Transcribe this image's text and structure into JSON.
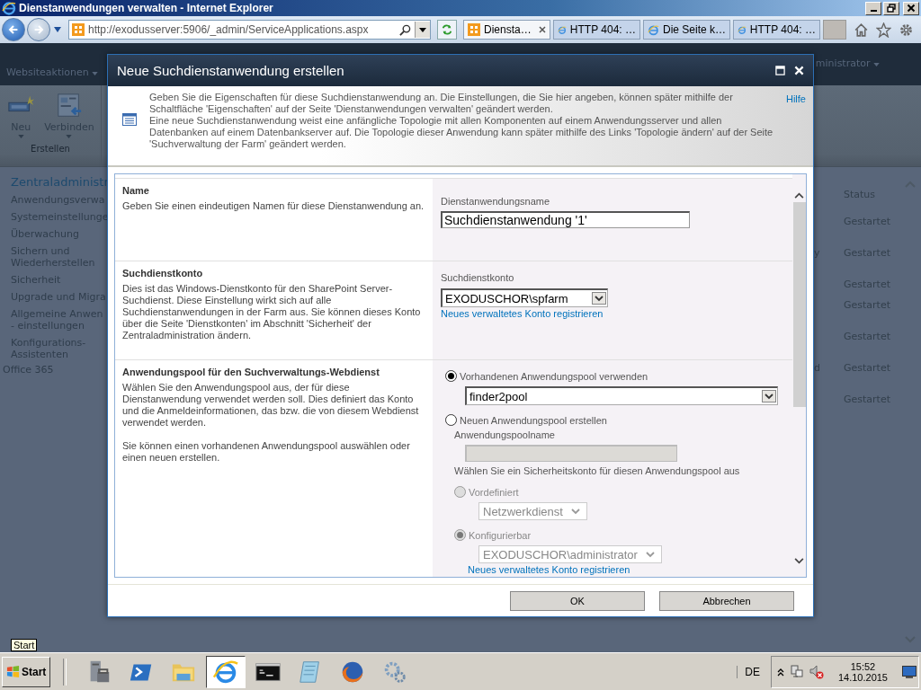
{
  "window": {
    "title": "Dienstanwendungen verwalten - Internet Explorer"
  },
  "address_bar": {
    "url": "http://exodusserver:5906/_admin/ServiceApplications.aspx"
  },
  "tabs": [
    {
      "label": "Diensta…",
      "selected": true
    },
    {
      "label": "HTTP 404: …",
      "selected": false
    },
    {
      "label": "Die Seite k…",
      "selected": false
    },
    {
      "label": "HTTP 404: …",
      "selected": false
    }
  ],
  "page": {
    "site_actions": "Websiteaktionen",
    "user": "ministrator",
    "ribbon": {
      "buttons": [
        "Neu",
        "Verbinden"
      ],
      "group": "Erstellen"
    },
    "nav_heading": "Zentraladministr",
    "nav": [
      "Anwendungsverwa",
      "Systemeinstellunge",
      "Überwachung",
      "Sichern und Wiederherstellen",
      "Sicherheit",
      "Upgrade und Migra",
      "Allgemeine Anwen\n- einstellungen",
      "Konfigurations-Assistenten"
    ],
    "nav_footer": "Office 365",
    "status_header": "Status",
    "status_rows": [
      {
        "status": "Gestartet"
      },
      {
        "column_1": "y",
        "status": "Gestartet"
      },
      {
        "status": "Gestartet"
      },
      {
        "status": "Gestartet"
      },
      {
        "status": "Gestartet"
      },
      {
        "column_1": "d",
        "status": "Gestartet"
      },
      {
        "status": "Gestartet"
      }
    ]
  },
  "dialog": {
    "title": "Neue Suchdienstanwendung erstellen",
    "intro": [
      "Geben Sie die Eigenschaften für diese Suchdienstanwendung an. Die Einstellungen, die Sie hier angeben, können später mithilfe der Schaltfläche 'Eigenschaften' auf der Seite 'Dienstanwendungen verwalten' geändert werden.",
      "Eine neue Suchdienstanwendung weist eine anfängliche Topologie mit allen Komponenten auf einem Anwendungsserver und allen Datenbanken auf einem Datenbankserver auf. Die Topologie dieser Anwendung kann später mithilfe des Links 'Topologie ändern' auf der Seite 'Suchverwaltung der Farm' geändert werden."
    ],
    "help_link": "Hilfe",
    "sections": [
      {
        "title": "Name",
        "description": [
          "Geben Sie einen eindeutigen Namen für diese Dienstanwendung an."
        ],
        "controls": [
          {
            "kind": "label",
            "text": "Dienstanwendungsname"
          },
          {
            "kind": "input",
            "value": "Suchdienstanwendung '1'",
            "disabled": false
          }
        ]
      },
      {
        "title": "Suchdienstkonto",
        "description": [
          "Dies ist das Windows-Dienstkonto für den SharePoint Server-Suchdienst. Diese Einstellung wirkt sich auf alle Suchdienstanwendungen in der Farm aus. Sie können dieses Konto über die Seite 'Dienstkonten' im Abschnitt 'Sicherheit' der Zentraladministration ändern."
        ],
        "controls": [
          {
            "kind": "label",
            "text": "Suchdienstkonto"
          },
          {
            "kind": "select",
            "value": "EXODUSCHOR\\spfarm",
            "disabled": false
          },
          {
            "kind": "link",
            "text": "Neues verwaltetes Konto registrieren"
          }
        ]
      },
      {
        "title": "Anwendungspool für den Suchverwaltungs-Webdienst",
        "description": [
          "Wählen Sie den Anwendungspool aus, der für diese Dienstanwendung verwendet werden soll. Dies definiert das Konto und die Anmeldeinformationen, das bzw. die von diesem Webdienst verwendet werden.",
          "Sie können einen vorhandenen Anwendungspool auswählen oder einen neuen erstellen."
        ],
        "controls": [
          {
            "kind": "radio",
            "text": "Vorhandenen Anwendungspool verwenden",
            "selected": true,
            "disabled": false,
            "children": [
              {
                "kind": "select",
                "value": "finder2pool",
                "disabled": false
              }
            ]
          },
          {
            "kind": "radio",
            "text": "Neuen Anwendungspool erstellen",
            "selected": false,
            "disabled": false,
            "children": [
              {
                "kind": "label",
                "text": "Anwendungspoolname"
              },
              {
                "kind": "input",
                "disabled": true
              },
              {
                "kind": "label",
                "text": "Wählen Sie ein Sicherheitskonto für diesen Anwendungspool aus"
              },
              {
                "kind": "radio",
                "text": "Vordefiniert",
                "selected": false,
                "disabled": true,
                "children": [
                  {
                    "kind": "select",
                    "value": "Netzwerkdienst",
                    "disabled": true
                  }
                ]
              },
              {
                "kind": "radio",
                "text": "Konfigurierbar",
                "selected": true,
                "disabled": true,
                "children": [
                  {
                    "kind": "select",
                    "value": "EXODUSCHOR\\administrator",
                    "disabled": true
                  },
                  {
                    "kind": "link",
                    "text": "Neues verwaltetes Konto registrieren"
                  }
                ]
              }
            ]
          }
        ]
      }
    ],
    "buttons": [
      "OK",
      "Abbrechen"
    ]
  },
  "taskbar": {
    "tooltip": "Start",
    "start": "Start",
    "apps": [
      {
        "selected": false
      },
      {
        "selected": false
      },
      {
        "selected": false
      },
      {
        "selected": true
      },
      {
        "selected": false
      },
      {
        "selected": false
      },
      {
        "selected": false
      },
      {
        "selected": false
      }
    ],
    "language": "DE",
    "clock": {
      "time": "15:52",
      "date": "14.10.2015"
    }
  }
}
